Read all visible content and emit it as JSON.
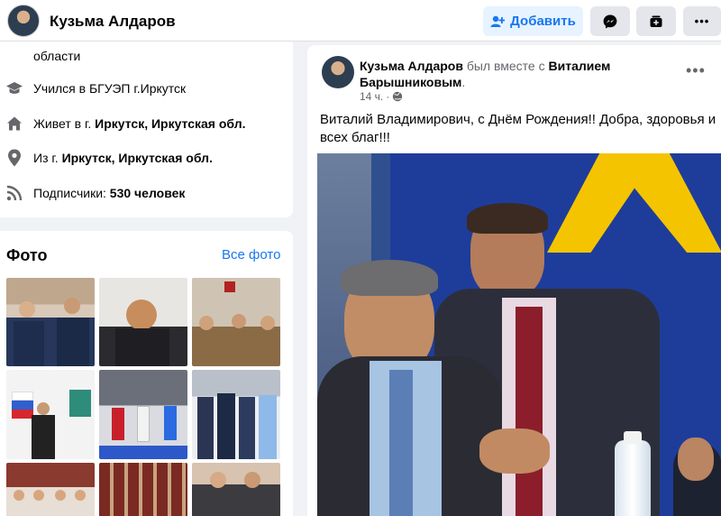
{
  "header": {
    "name": "Кузьма Алдаров",
    "add_label": "Добавить"
  },
  "intro": {
    "region_text": "области",
    "education_text": "Учился в БГУЭП г.Иркутск",
    "lives_prefix": "Живет в г. ",
    "lives_city": "Иркутск, Иркутская обл.",
    "from_prefix": "Из г. ",
    "from_city": "Иркутск, Иркутская обл.",
    "followers_prefix": "Подписчики: ",
    "followers_value": "530 человек"
  },
  "photos": {
    "title": "Фото",
    "all_link": "Все фото"
  },
  "post": {
    "author": "Кузьма Алдаров",
    "with_text": " был вместе с ",
    "tagged": "Виталием Барышниковым",
    "period": ".",
    "time": "14 ч.",
    "separator": "·",
    "text": "Виталий Владимирович, с Днём Рождения!! Добра, здоровья и всех благ!!!",
    "more": "•••"
  },
  "icons": {
    "education": "graduation-cap-icon",
    "home": "home-icon",
    "location": "location-pin-icon",
    "followers": "rss-icon",
    "audience": "globe-icon"
  },
  "colors": {
    "accent": "#1877f2",
    "accent_bg": "#e7f3ff",
    "secondary_text": "#65676b",
    "page_bg": "#f0f2f5"
  }
}
